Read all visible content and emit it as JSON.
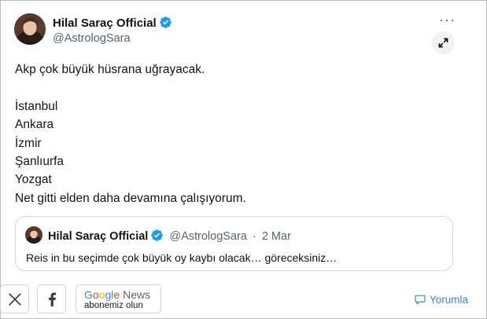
{
  "tweet": {
    "author_name": "Hilal Saraç Official",
    "author_handle": "@AstrologSara",
    "more_label": "···",
    "lines": [
      "Akp çok büyük hüsrana uğrayacak.",
      "",
      "İstanbul",
      "Ankara",
      "İzmir",
      "Şanlıurfa",
      "Yozgat",
      "Net gitti elden daha devamına çalışıyorum."
    ],
    "quote": {
      "author_name": "Hilal Saraç Official",
      "author_handle": "@AstrologSara",
      "separator": "·",
      "date": "2 Mar",
      "text": "Reis in bu seçimde çok büyük oy kaybı olacak… göreceksiniz…"
    }
  },
  "toolbar": {
    "google_letters": [
      {
        "ch": "G",
        "color": "#4285F4"
      },
      {
        "ch": "o",
        "color": "#EA4335"
      },
      {
        "ch": "o",
        "color": "#FBBC05"
      },
      {
        "ch": "g",
        "color": "#4285F4"
      },
      {
        "ch": "l",
        "color": "#34A853"
      },
      {
        "ch": "e",
        "color": "#EA4335"
      }
    ],
    "news_word": "News",
    "subscribe_label": "abonemiz olun",
    "comment_label": "Yorumla"
  },
  "colors": {
    "text": "#0f1419",
    "secondary": "#536471",
    "verified": "#1d9bf0",
    "link": "#3d86c6",
    "border": "#cfd9de"
  },
  "icons": [
    "avatar",
    "verified-badge-icon",
    "more-icon",
    "expand-icon",
    "x-logo-icon",
    "facebook-icon",
    "comment-icon"
  ]
}
